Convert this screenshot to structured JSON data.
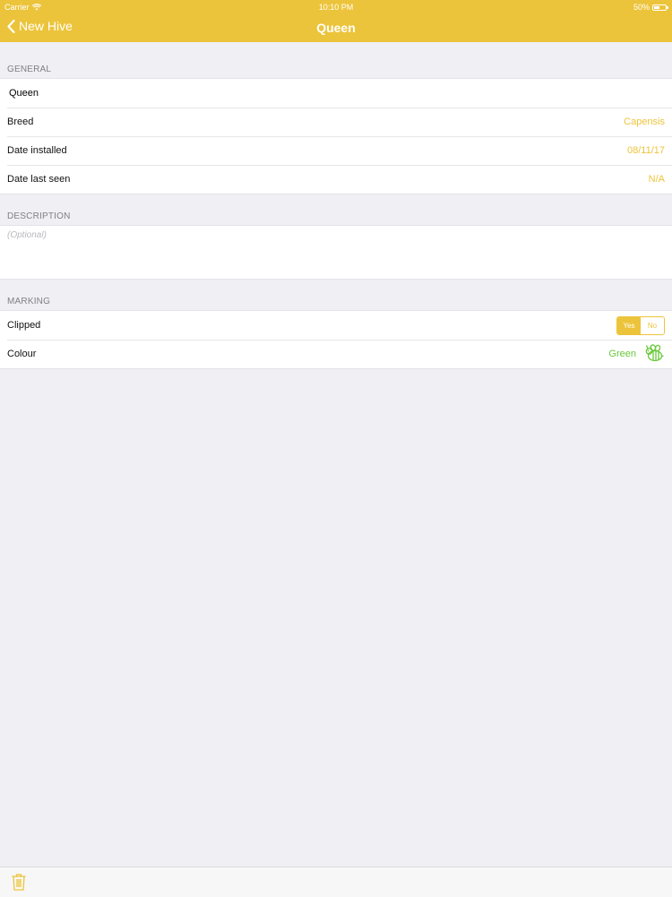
{
  "status": {
    "carrier": "Carrier",
    "time": "10:10 PM",
    "battery": "50%",
    "battery_level": 0.5
  },
  "nav": {
    "back_label": "New Hive",
    "title": "Queen"
  },
  "general": {
    "header": "GENERAL",
    "name_value": "Queen",
    "rows": [
      {
        "label": "Breed",
        "value": "Capensis"
      },
      {
        "label": "Date installed",
        "value": "08/11/17"
      },
      {
        "label": "Date last seen",
        "value": "N/A"
      }
    ]
  },
  "description": {
    "header": "DESCRIPTION",
    "placeholder": "(Optional)"
  },
  "marking": {
    "header": "MARKING",
    "clipped": {
      "label": "Clipped",
      "options": [
        "Yes",
        "No"
      ],
      "selected": "Yes"
    },
    "colour": {
      "label": "Colour",
      "value": "Green",
      "color": "#69c83a"
    }
  },
  "theme": {
    "accent": "#ecc43b",
    "background": "#efeff4"
  }
}
